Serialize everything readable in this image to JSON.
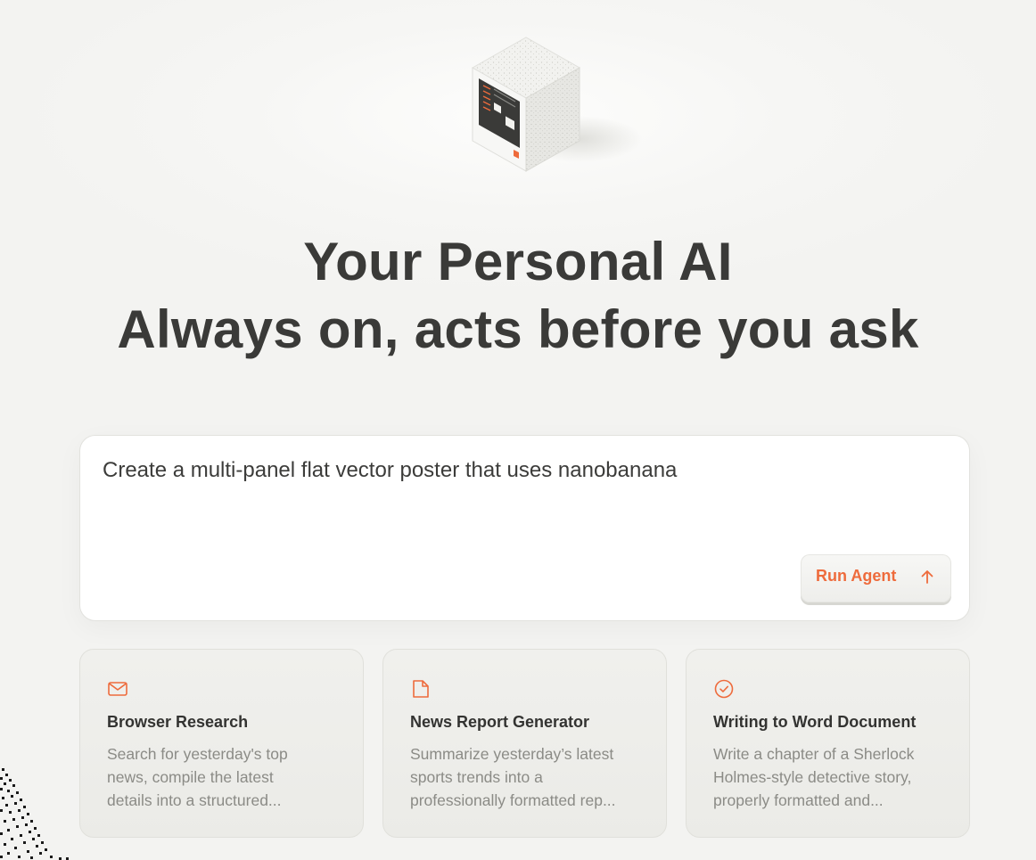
{
  "hero": {
    "line1": "Your Personal AI",
    "line2": "Always on, acts before you ask"
  },
  "prompt": {
    "value": "Create a multi-panel flat vector poster that uses nanobanana",
    "run_label": "Run Agent"
  },
  "cards": [
    {
      "icon": "mail-icon",
      "title": "Browser Research",
      "desc_lines": [
        "Search for yesterday's top",
        "news, compile the latest",
        "details into a structured..."
      ]
    },
    {
      "icon": "document-icon",
      "title": "News Report Generator",
      "desc_lines": [
        "Summarize yesterday’s latest",
        "sports trends into a",
        "professionally formatted rep..."
      ]
    },
    {
      "icon": "check-circle-icon",
      "title": "Writing to Word Document",
      "desc_lines": [
        "Write a chapter of a Sherlock",
        "Holmes-style detective story,",
        "properly formatted and..."
      ]
    }
  ],
  "colors": {
    "accent": "#ee6b3c",
    "background": "#f4f4f2",
    "card_bg": "#eeeeea",
    "text": "#3a3a38",
    "muted": "#8b8b86"
  }
}
